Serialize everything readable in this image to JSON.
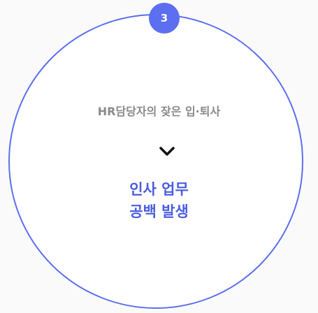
{
  "step": {
    "number": "3"
  },
  "cause": {
    "text": "HR담당자의 잦은 입·퇴사"
  },
  "arrow": {
    "icon": "chevron-down-icon"
  },
  "result": {
    "line1": "인사 업무",
    "line2": "공백 발생"
  },
  "colors": {
    "accent": "#5b6ff0",
    "result_text": "#4a5de0",
    "cause_text": "#8a8a8a"
  }
}
